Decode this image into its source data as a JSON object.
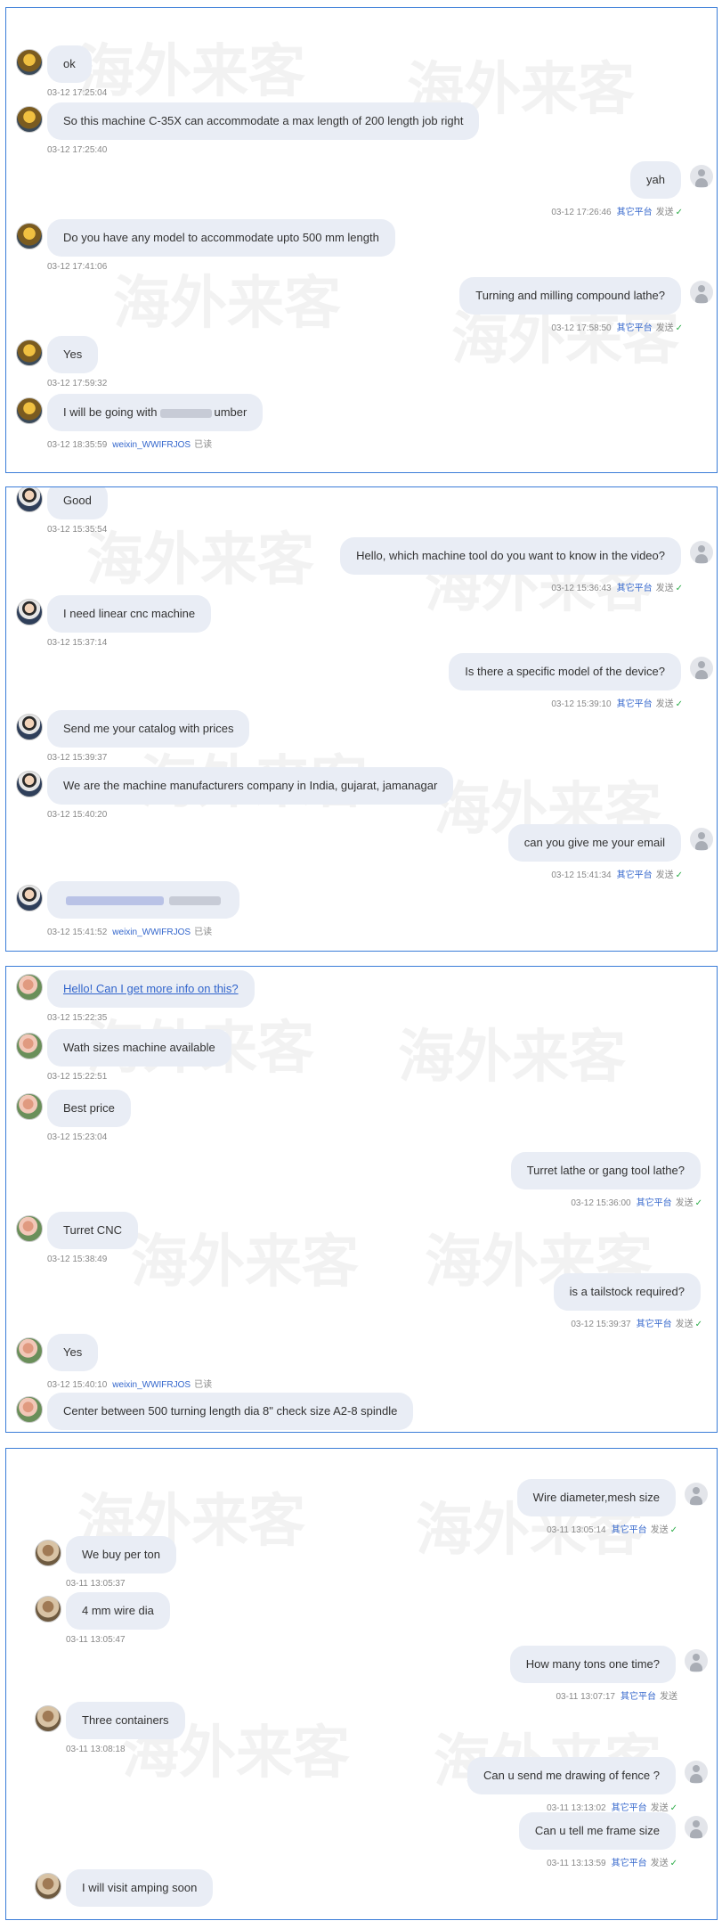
{
  "platform_label": "其它平台",
  "status_sent": "发送",
  "status_read": "已读",
  "panels": [
    {
      "messages": [
        {
          "side": "left",
          "text": "ok",
          "time": "03-12 17:25:04"
        },
        {
          "side": "left",
          "text": "So this machine C-35X can accommodate a max length of 200 length job right",
          "time": "03-12 17:25:40"
        },
        {
          "side": "right",
          "text": "yah",
          "time": "03-12 17:26:46"
        },
        {
          "side": "left",
          "text": "Do you have any model to accommodate upto 500 mm length",
          "time": "03-12 17:41:06"
        },
        {
          "side": "right",
          "text": "Turning and milling compound lathe?",
          "time": "03-12 17:58:50"
        },
        {
          "side": "left",
          "text": "Yes",
          "time": "03-12 17:59:32"
        },
        {
          "side": "left",
          "text_before": "I will be going with",
          "text_after": "umber",
          "time": "03-12 18:35:59",
          "uid": "weixin_WWIFRJOS"
        }
      ]
    },
    {
      "messages": [
        {
          "side": "left",
          "text": "Good",
          "time": "03-12 15:35:54"
        },
        {
          "side": "right",
          "text": "Hello, which machine tool do you want to know in the video?",
          "time": "03-12 15:36:43"
        },
        {
          "side": "left",
          "text": "I need linear cnc machine",
          "time": "03-12 15:37:14"
        },
        {
          "side": "right",
          "text": "Is there a specific model of the device?",
          "time": "03-12 15:39:10"
        },
        {
          "side": "left",
          "text": "Send me your catalog with prices",
          "time": "03-12 15:39:37"
        },
        {
          "side": "left",
          "text": "We are the machine manufacturers company in India, gujarat, jamanagar",
          "time": "03-12 15:40:20"
        },
        {
          "side": "right",
          "text": "can you give me your email",
          "time": "03-12 15:41:34"
        },
        {
          "side": "left",
          "text": "",
          "time": "03-12 15:41:52",
          "uid": "weixin_WWIFRJOS"
        }
      ]
    },
    {
      "messages": [
        {
          "side": "left",
          "text": "Hello! Can I get more info on this?",
          "time": "03-12 15:22:35"
        },
        {
          "side": "left",
          "text": "Wath sizes machine available",
          "time": "03-12 15:22:51"
        },
        {
          "side": "left",
          "text": "Best price",
          "time": "03-12 15:23:04"
        },
        {
          "side": "right",
          "text": "Turret lathe or gang tool lathe?",
          "time": "03-12 15:36:00"
        },
        {
          "side": "left",
          "text": "Turret CNC",
          "time": "03-12 15:38:49"
        },
        {
          "side": "right",
          "text": "is a tailstock required?",
          "time": "03-12 15:39:37"
        },
        {
          "side": "left",
          "text": "Yes",
          "time": "03-12 15:40:10",
          "uid": "weixin_WWIFRJOS"
        },
        {
          "side": "left",
          "text": "Center between 500 turning length dia 8\" check size A2-8 spindle",
          "time": ""
        }
      ]
    },
    {
      "messages": [
        {
          "side": "right",
          "text": "Wire diameter,mesh size",
          "time": "03-11 13:05:14"
        },
        {
          "side": "left",
          "text": "We buy per ton",
          "time": "03-11 13:05:37"
        },
        {
          "side": "left",
          "text": "4 mm wire dia",
          "time": "03-11 13:05:47"
        },
        {
          "side": "right",
          "text": "How many tons one time?",
          "time": "03-11 13:07:17"
        },
        {
          "side": "left",
          "text": "Three containers",
          "time": "03-11 13:08:18"
        },
        {
          "side": "right",
          "text": "Can u send me drawing of fence ?",
          "time": "03-11 13:13:02"
        },
        {
          "side": "right",
          "text": "Can u tell me frame size",
          "time": "03-11 13:13:59"
        },
        {
          "side": "left",
          "text": "I will visit amping soon",
          "time": ""
        }
      ]
    }
  ],
  "watermark": "海外来客"
}
